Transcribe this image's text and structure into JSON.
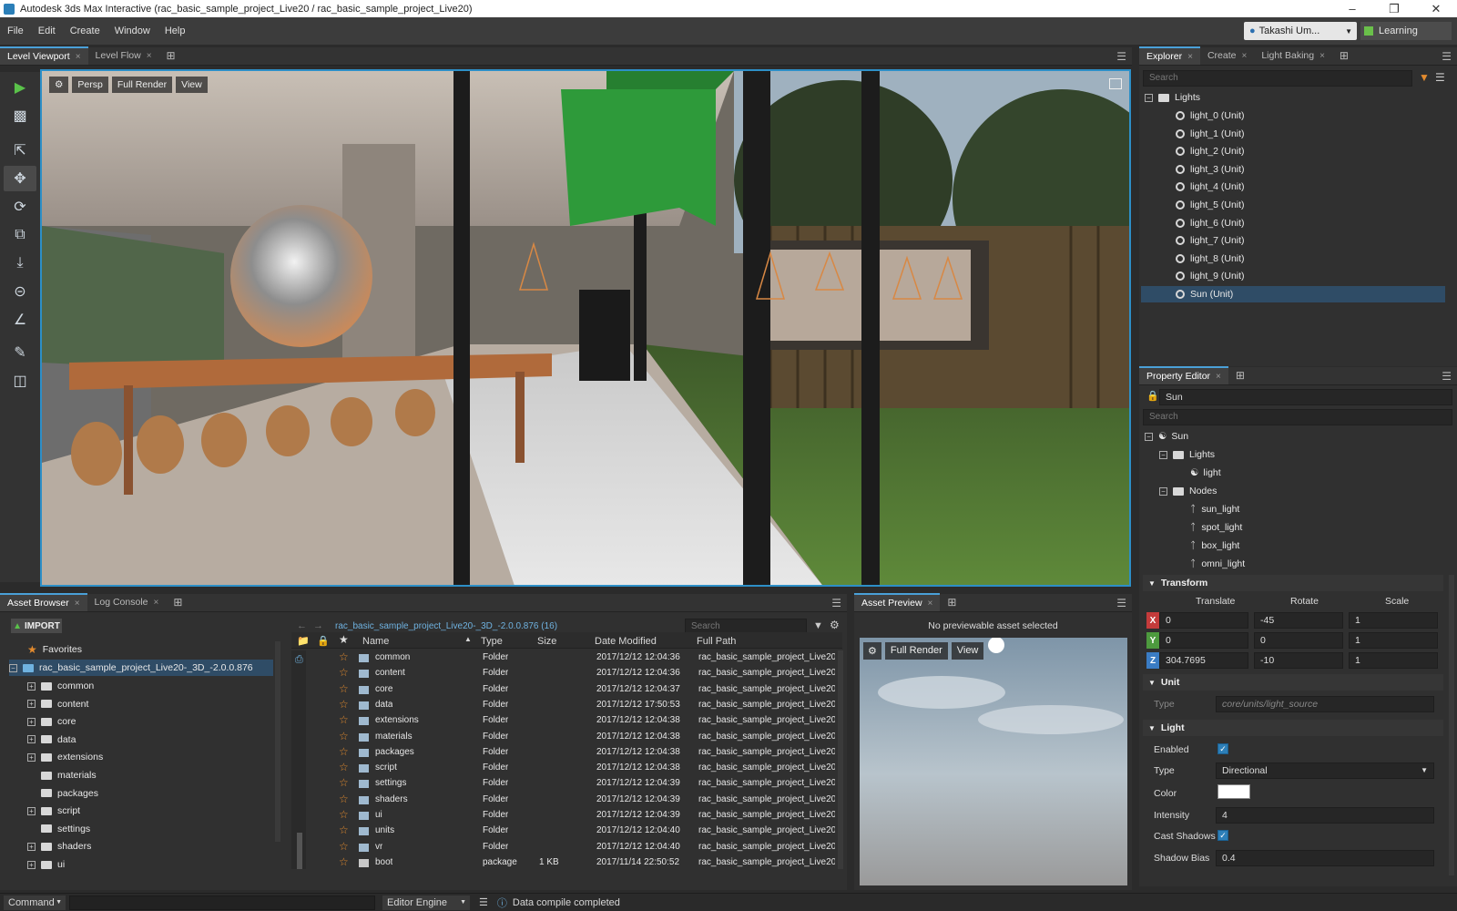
{
  "window": {
    "title": "Autodesk 3ds Max Interactive (rac_basic_sample_project_Live20 / rac_basic_sample_project_Live20)",
    "buttons": [
      "–",
      "❐",
      "✕"
    ]
  },
  "menu": [
    "File",
    "Edit",
    "Create",
    "Window",
    "Help"
  ],
  "user": {
    "name": "Takashi Um...",
    "learning": "Learning"
  },
  "viewport_tabs": [
    {
      "label": "Level Viewport",
      "close": "×"
    },
    {
      "label": "Level Flow",
      "close": "×"
    }
  ],
  "viewport": {
    "settings_icon": "gear-icon",
    "buttons": [
      "Persp",
      "Full Render",
      "View"
    ]
  },
  "tools": [
    "play-icon",
    "gamepad-icon",
    "select-icon",
    "move-icon",
    "rotate-icon",
    "scale-icon",
    "snap-to-ground-icon",
    "snap-icon",
    "measure-icon",
    "paint-icon",
    "layers-icon"
  ],
  "explorer": {
    "tabs": [
      "Explorer",
      "Create",
      "Light Baking"
    ],
    "search_placeholder": "Search",
    "root": "Lights",
    "items": [
      "light_0 (Unit)",
      "light_1 (Unit)",
      "light_2 (Unit)",
      "light_3 (Unit)",
      "light_4 (Unit)",
      "light_5 (Unit)",
      "light_6 (Unit)",
      "light_7 (Unit)",
      "light_8 (Unit)",
      "light_9 (Unit)",
      "Sun (Unit)"
    ],
    "selected_index": 10
  },
  "property_editor": {
    "tab": "Property Editor",
    "name_value": "Sun",
    "search_placeholder": "Search",
    "tree": {
      "root": "Sun",
      "lights_folder": "Lights",
      "light": "light",
      "nodes_folder": "Nodes",
      "nodes": [
        "sun_light",
        "spot_light",
        "box_light",
        "omni_light"
      ]
    },
    "transform": {
      "header": "Transform",
      "col_translate": "Translate",
      "col_rotate": "Rotate",
      "col_scale": "Scale",
      "rows": [
        {
          "axis": "X",
          "translate": "0",
          "rotate": "-45",
          "scale": "1",
          "color": "#c43b3b"
        },
        {
          "axis": "Y",
          "translate": "0",
          "rotate": "0",
          "scale": "1",
          "color": "#4d9a3e"
        },
        {
          "axis": "Z",
          "translate": "304.7695",
          "rotate": "-10",
          "scale": "1",
          "color": "#3a7cc4"
        }
      ]
    },
    "unit": {
      "header": "Unit",
      "type_label": "Type",
      "type_value": "core/units/light_source"
    },
    "light": {
      "header": "Light",
      "enabled_label": "Enabled",
      "type_label": "Type",
      "type_value": "Directional",
      "color_label": "Color",
      "color_value": "#ffffff",
      "intensity_label": "Intensity",
      "intensity_value": "4",
      "cast_shadows_label": "Cast Shadows",
      "shadow_bias_label": "Shadow Bias",
      "shadow_bias_value": "0.4"
    }
  },
  "asset_browser": {
    "tabs": [
      "Asset Browser",
      "Log Console"
    ],
    "import": "IMPORT",
    "path": "rac_basic_sample_project_Live20-_3D_-2.0.0.876 (16)",
    "search_placeholder": "Search",
    "favorites": "Favorites",
    "root": "rac_basic_sample_project_Live20-_3D_-2.0.0.876",
    "tree": [
      "common",
      "content",
      "core",
      "data",
      "extensions",
      "materials",
      "packages",
      "script",
      "settings",
      "shaders",
      "ui"
    ],
    "columns": [
      "Name",
      "Type",
      "Size",
      "Date Modified",
      "Full Path"
    ],
    "rows": [
      {
        "name": "common",
        "type": "Folder",
        "size": "",
        "date": "2017/12/12 12:04:36",
        "path": "rac_basic_sample_project_Live20-_..."
      },
      {
        "name": "content",
        "type": "Folder",
        "size": "",
        "date": "2017/12/12 12:04:36",
        "path": "rac_basic_sample_project_Live20-_..."
      },
      {
        "name": "core",
        "type": "Folder",
        "size": "",
        "date": "2017/12/12 12:04:37",
        "path": "rac_basic_sample_project_Live20-_..."
      },
      {
        "name": "data",
        "type": "Folder",
        "size": "",
        "date": "2017/12/12 17:50:53",
        "path": "rac_basic_sample_project_Live20-_..."
      },
      {
        "name": "extensions",
        "type": "Folder",
        "size": "",
        "date": "2017/12/12 12:04:38",
        "path": "rac_basic_sample_project_Live20-_..."
      },
      {
        "name": "materials",
        "type": "Folder",
        "size": "",
        "date": "2017/12/12 12:04:38",
        "path": "rac_basic_sample_project_Live20-_..."
      },
      {
        "name": "packages",
        "type": "Folder",
        "size": "",
        "date": "2017/12/12 12:04:38",
        "path": "rac_basic_sample_project_Live20-_..."
      },
      {
        "name": "script",
        "type": "Folder",
        "size": "",
        "date": "2017/12/12 12:04:38",
        "path": "rac_basic_sample_project_Live20-_..."
      },
      {
        "name": "settings",
        "type": "Folder",
        "size": "",
        "date": "2017/12/12 12:04:39",
        "path": "rac_basic_sample_project_Live20-_..."
      },
      {
        "name": "shaders",
        "type": "Folder",
        "size": "",
        "date": "2017/12/12 12:04:39",
        "path": "rac_basic_sample_project_Live20-_..."
      },
      {
        "name": "ui",
        "type": "Folder",
        "size": "",
        "date": "2017/12/12 12:04:39",
        "path": "rac_basic_sample_project_Live20-_..."
      },
      {
        "name": "units",
        "type": "Folder",
        "size": "",
        "date": "2017/12/12 12:04:40",
        "path": "rac_basic_sample_project_Live20-_..."
      },
      {
        "name": "vr",
        "type": "Folder",
        "size": "",
        "date": "2017/12/12 12:04:40",
        "path": "rac_basic_sample_project_Live20-_..."
      },
      {
        "name": "boot",
        "type": "package",
        "size": "1 KB",
        "date": "2017/11/14 22:50:52",
        "path": "rac_basic_sample_project_Live20-_..."
      }
    ]
  },
  "asset_preview": {
    "tab": "Asset Preview",
    "message": "No previewable asset selected",
    "buttons": [
      "Full Render",
      "View"
    ]
  },
  "status": {
    "command": "Command",
    "engine": "Editor Engine",
    "message": "Data compile completed"
  },
  "colors": {
    "accent": "#2d8fc7",
    "selection": "#2f4c66",
    "star": "#e38b2e"
  }
}
